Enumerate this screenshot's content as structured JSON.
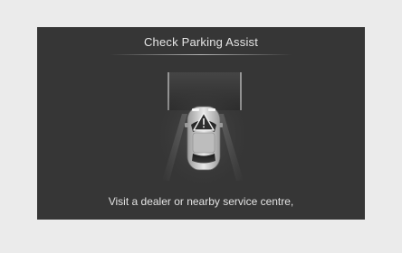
{
  "screen": {
    "title": "Check Parking Assist",
    "message": "Visit a dealer or nearby service centre,"
  },
  "icons": {
    "warning": "warning-triangle-icon",
    "vehicle": "car-top-view-icon"
  },
  "colors": {
    "page_background": "#ebebeb",
    "display_background": "#363636",
    "text": "#e6e6e6"
  }
}
